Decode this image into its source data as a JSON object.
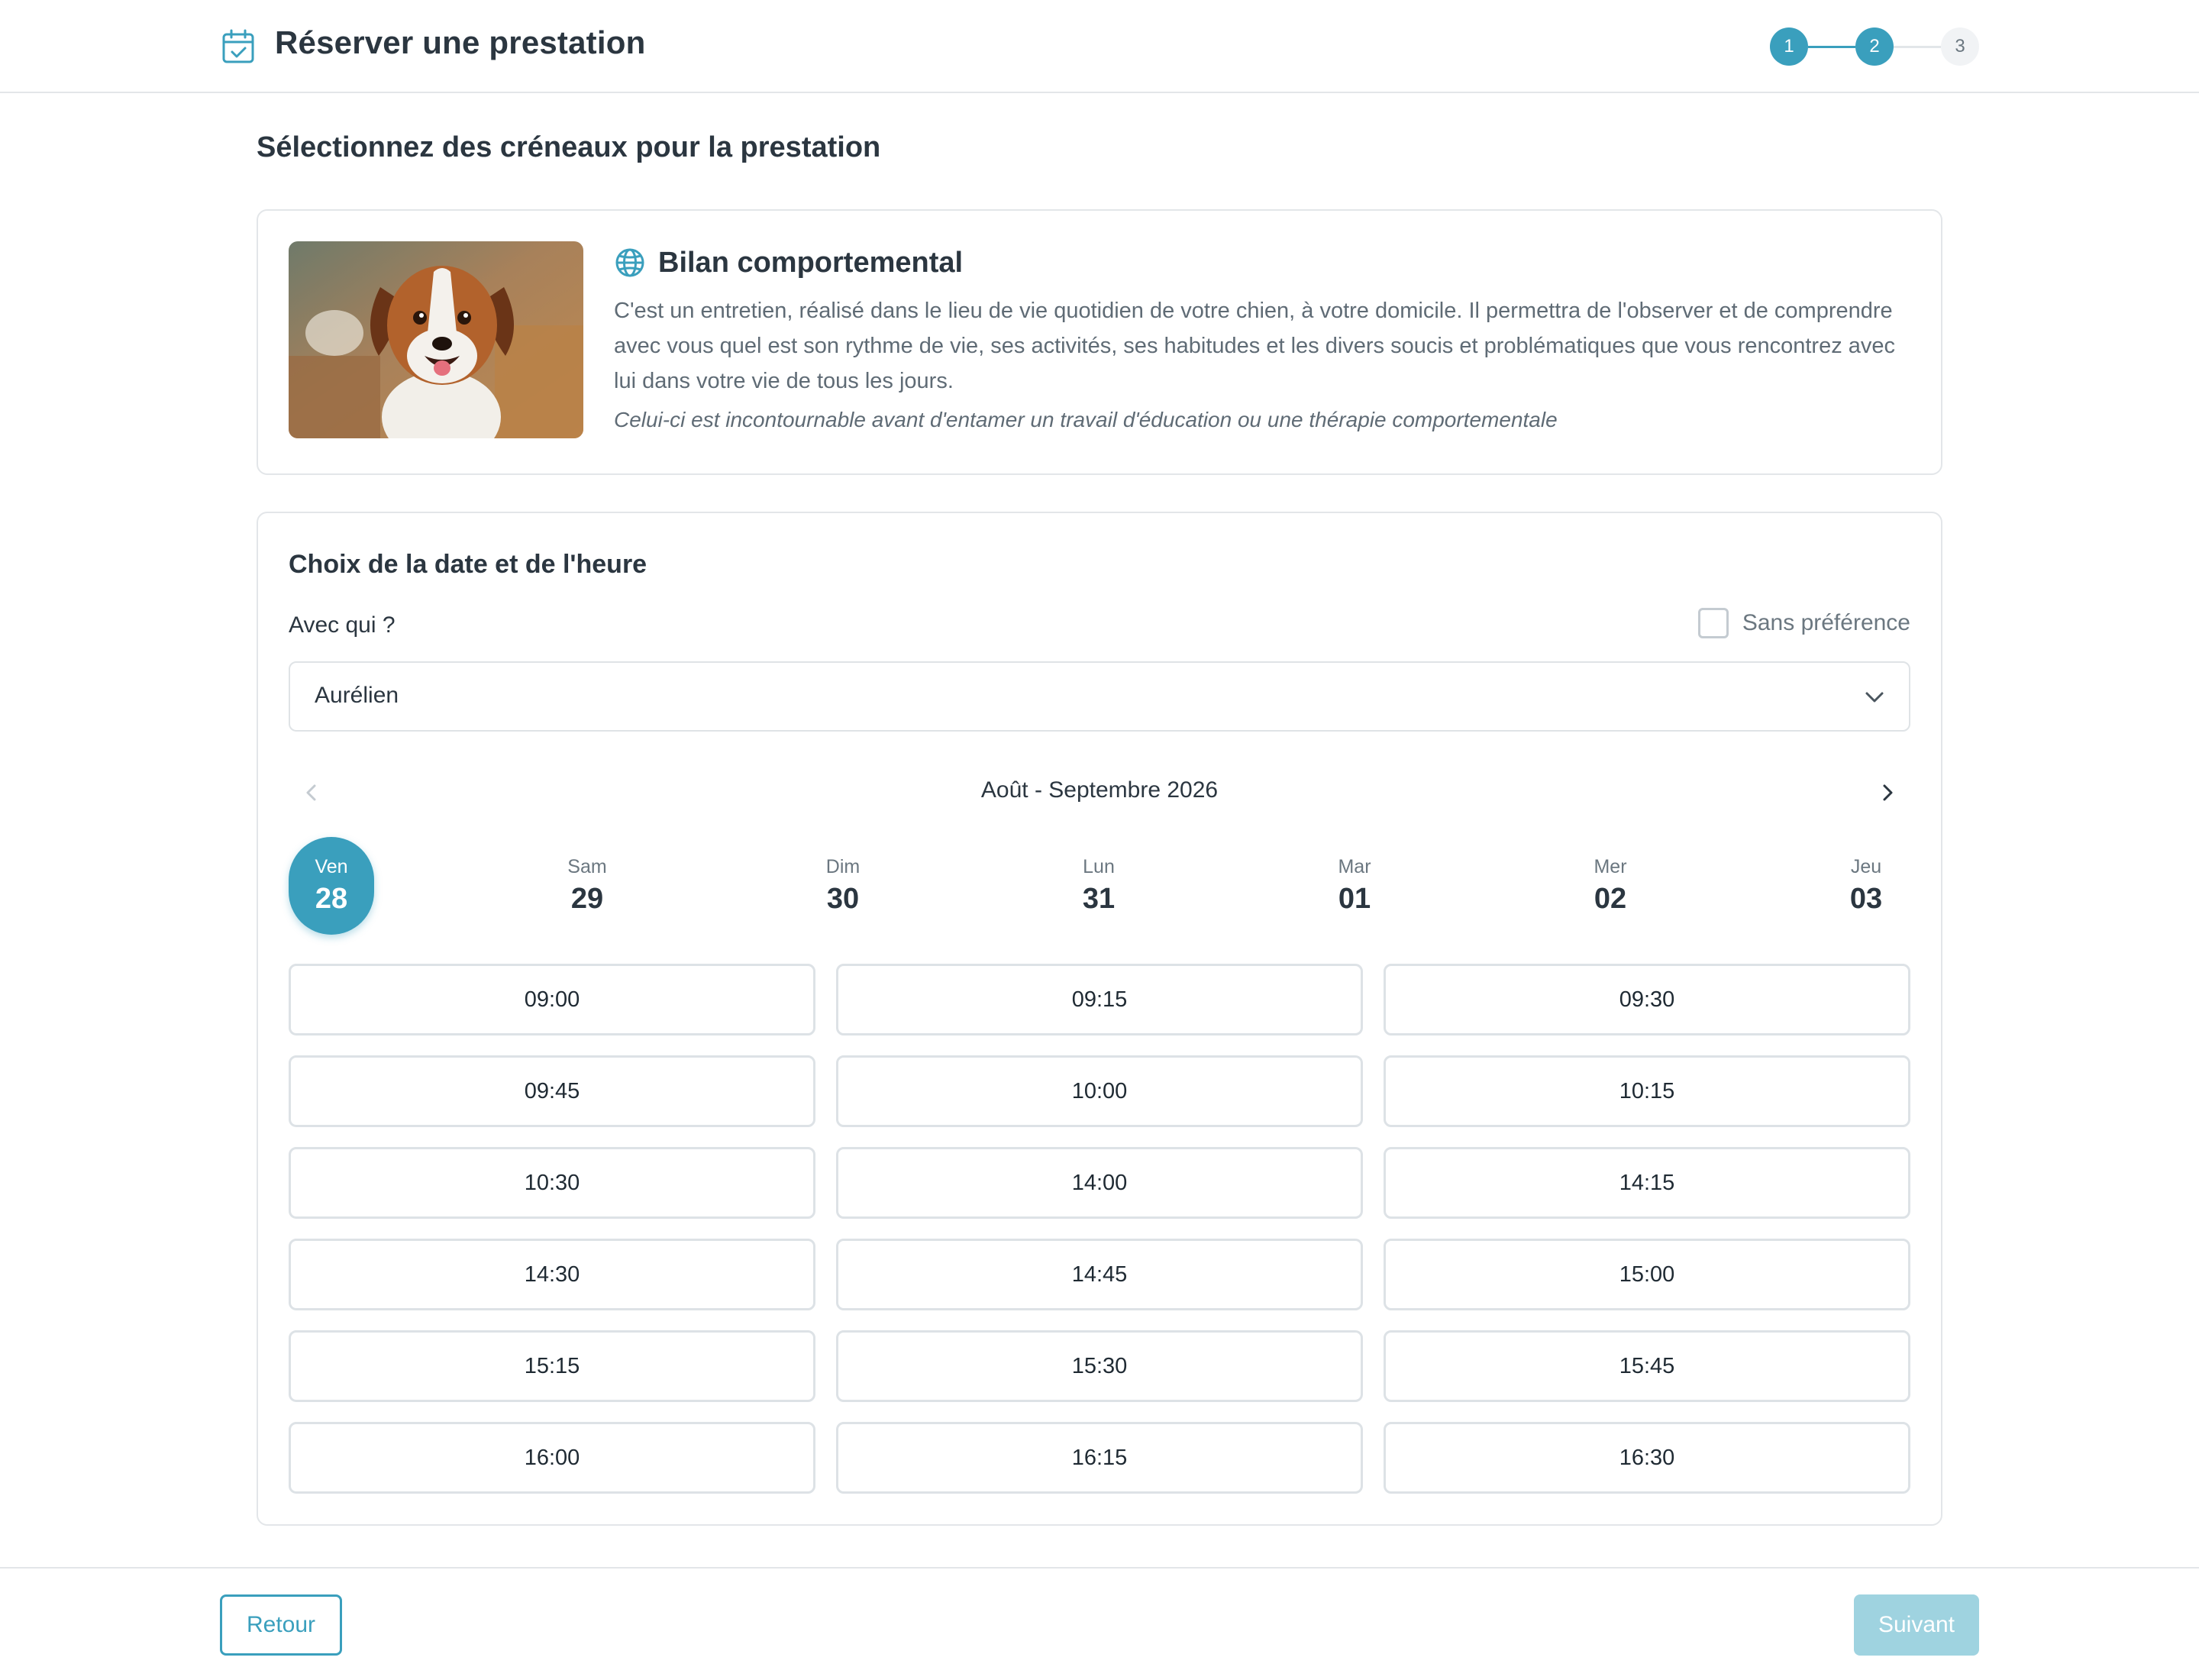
{
  "header": {
    "title": "Réserver une prestation",
    "icon": "calendar-check-icon",
    "steps": [
      "1",
      "2",
      "3"
    ],
    "current_step": 2
  },
  "page": {
    "section_title": "Sélectionnez des créneaux pour la prestation"
  },
  "service": {
    "icon": "globe-icon",
    "name": "Bilan comportemental",
    "description": "C'est un entretien, réalisé dans le lieu de vie quotidien de votre chien, à votre domicile. Il permettra de l'observer et de comprendre avec vous quel est son rythme de vie, ses activités, ses habitudes et les divers soucis et problématiques que vous rencontrez avec lui dans votre vie de tous les jours.",
    "note": "Celui-ci est incontournable avant d'entamer un travail d'éducation ou une thérapie comportementale"
  },
  "booking": {
    "title": "Choix de la date et de l'heure",
    "who_label": "Avec qui ?",
    "no_preference_label": "Sans préférence",
    "no_preference_checked": false,
    "selected_person": "Aurélien",
    "month_label": "Août - Septembre 2026",
    "days": [
      {
        "name": "Ven",
        "num": "28",
        "selected": true
      },
      {
        "name": "Sam",
        "num": "29",
        "selected": false
      },
      {
        "name": "Dim",
        "num": "30",
        "selected": false
      },
      {
        "name": "Lun",
        "num": "31",
        "selected": false
      },
      {
        "name": "Mar",
        "num": "01",
        "selected": false
      },
      {
        "name": "Mer",
        "num": "02",
        "selected": false
      },
      {
        "name": "Jeu",
        "num": "03",
        "selected": false
      }
    ],
    "slots": [
      "09:00",
      "09:15",
      "09:30",
      "09:45",
      "10:00",
      "10:15",
      "10:30",
      "14:00",
      "14:15",
      "14:30",
      "14:45",
      "15:00",
      "15:15",
      "15:30",
      "15:45",
      "16:00",
      "16:15",
      "16:30"
    ]
  },
  "footer": {
    "back_label": "Retour",
    "next_label": "Suivant"
  },
  "colors": {
    "accent": "#3a9fbd",
    "accent_disabled": "#9fd3e0",
    "border": "#e3e6e9"
  }
}
